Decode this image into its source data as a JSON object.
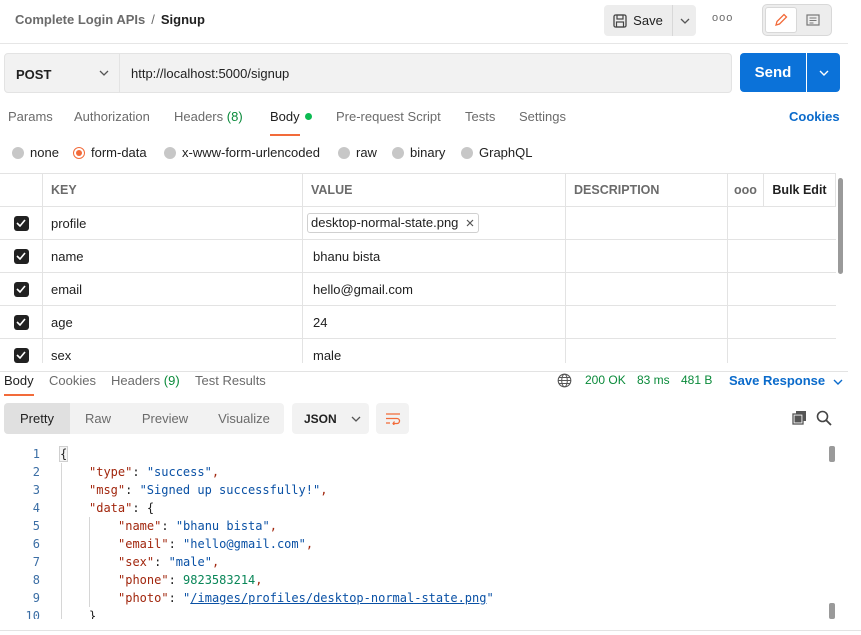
{
  "header": {
    "collection": "Complete Login APIs",
    "separator": "/",
    "request_name": "Signup",
    "save_label": "Save",
    "more_label": "ooo"
  },
  "request": {
    "method": "POST",
    "url": "http://localhost:5000/signup",
    "send_label": "Send"
  },
  "request_tabs": [
    {
      "label": "Params"
    },
    {
      "label": "Authorization"
    },
    {
      "label": "Headers",
      "count": "(8)"
    },
    {
      "label": "Body"
    },
    {
      "label": "Pre-request Script"
    },
    {
      "label": "Tests"
    },
    {
      "label": "Settings"
    }
  ],
  "cookies_label": "Cookies",
  "body_types": [
    {
      "label": "none",
      "selected": false
    },
    {
      "label": "form-data",
      "selected": true
    },
    {
      "label": "x-www-form-urlencoded",
      "selected": false
    },
    {
      "label": "raw",
      "selected": false
    },
    {
      "label": "binary",
      "selected": false
    },
    {
      "label": "GraphQL",
      "selected": false
    }
  ],
  "form_table": {
    "headers": {
      "key": "KEY",
      "value": "VALUE",
      "description": "DESCRIPTION",
      "more": "ooo",
      "bulk_edit": "Bulk Edit"
    },
    "rows": [
      {
        "key": "profile",
        "value": "desktop-normal-state.png",
        "checked": true,
        "is_file": true
      },
      {
        "key": "name",
        "value": "bhanu bista",
        "checked": true
      },
      {
        "key": "email",
        "value": "hello@gmail.com",
        "checked": true
      },
      {
        "key": "age",
        "value": "24",
        "checked": true
      },
      {
        "key": "sex",
        "value": "male",
        "checked": true
      }
    ]
  },
  "response_tabs": [
    {
      "label": "Body"
    },
    {
      "label": "Cookies"
    },
    {
      "label": "Headers",
      "count": "(9)"
    },
    {
      "label": "Test Results"
    }
  ],
  "response_status": {
    "status": "200 OK",
    "time": "83 ms",
    "size": "481 B"
  },
  "save_response_label": "Save Response",
  "view_modes": [
    "Pretty",
    "Raw",
    "Preview",
    "Visualize"
  ],
  "format_select": "JSON",
  "code_lines": [
    {
      "n": "1",
      "text": "{"
    },
    {
      "n": "2",
      "text": "\"type\": \"success\","
    },
    {
      "n": "3",
      "text": "\"msg\": \"Signed up successfully!\","
    },
    {
      "n": "4",
      "text": "\"data\": {"
    },
    {
      "n": "5",
      "text": "\"name\": \"bhanu bista\","
    },
    {
      "n": "6",
      "text": "\"email\": \"hello@gmail.com\","
    },
    {
      "n": "7",
      "text": "\"sex\": \"male\","
    },
    {
      "n": "8",
      "text": "\"phone\": 9823583214,"
    },
    {
      "n": "9",
      "text": "\"photo\": \"/images/profiles/desktop-normal-state.png\""
    },
    {
      "n": "10",
      "text": "}"
    }
  ],
  "colors": {
    "accent": "#f26b3a",
    "send": "#0b72d9",
    "link": "#0b6bcb",
    "success": "#0a8a3a"
  }
}
